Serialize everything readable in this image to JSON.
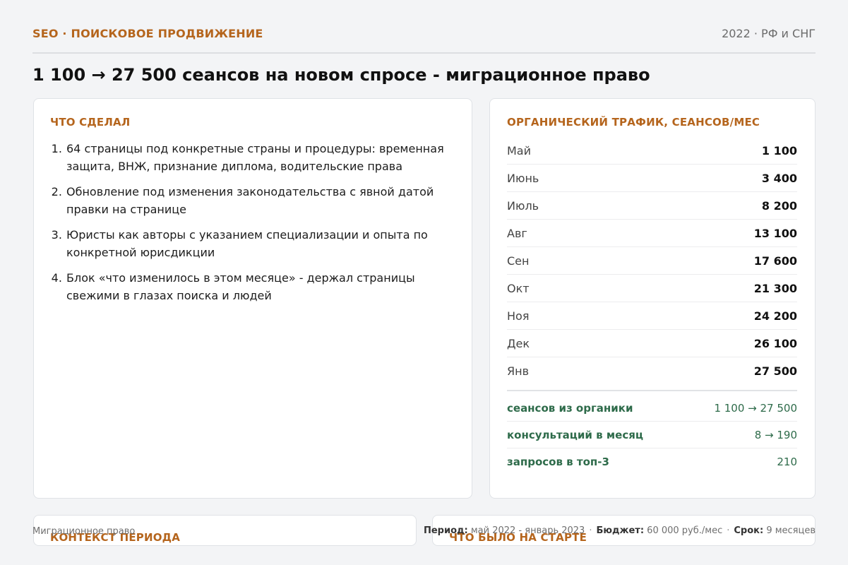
{
  "header": {
    "section": "SEO · ПОИСКОВОЕ ПРОДВИЖЕНИЕ",
    "meta": "2022  ·  РФ и СНГ"
  },
  "headline": "1 100 → 27 500 сеансов на новом спросе - миграционное право",
  "did": {
    "title": "ЧТО СДЕЛАЛ",
    "items": [
      "64 страницы под конкретные страны и процедуры: временная защита, ВНЖ, признание диплома, водительские права",
      "Обновление под изменения законодательства с явной датой правки на странице",
      "Юристы как авторы с указанием специализации и опыта по конкретной юрисдикции",
      "Блок «что изменилось в этом месяце» - держал страницы свежими в глазах поиска и людей"
    ]
  },
  "traffic": {
    "title": "ОРГАНИЧЕСКИЙ ТРАФИК, СЕАНСОВ/МЕС",
    "rows": [
      {
        "month": "Май",
        "value": "1 100"
      },
      {
        "month": "Июнь",
        "value": "3 400"
      },
      {
        "month": "Июль",
        "value": "8 200"
      },
      {
        "month": "Авг",
        "value": "13 100"
      },
      {
        "month": "Сен",
        "value": "17 600"
      },
      {
        "month": "Окт",
        "value": "21 300"
      },
      {
        "month": "Ноя",
        "value": "24 200"
      },
      {
        "month": "Дек",
        "value": "26 100"
      },
      {
        "month": "Янв",
        "value": "27 500"
      }
    ],
    "kpis": [
      {
        "label": "сеансов из органики",
        "value": "1 100 → 27 500"
      },
      {
        "label": "консультаций в месяц",
        "value": "8 → 190"
      },
      {
        "label": "запросов в топ-3",
        "value": "210"
      }
    ]
  },
  "context": {
    "title": "КОНТЕКСТ ПЕРИОДА"
  },
  "start": {
    "title": "ЧТО БЫЛО НА СТАРТЕ"
  },
  "footer": {
    "left": "Миграционное право",
    "period_label": "Период:",
    "period_value": "май 2022 - январь 2023",
    "budget_label": "Бюджет:",
    "budget_value": "60 000 руб./мес",
    "term_label": "Срок:",
    "term_value": "9 месяцев"
  },
  "colors": {
    "accent": "#b5651d",
    "kpi": "#2e6b4a",
    "background": "#f3f4f6"
  }
}
